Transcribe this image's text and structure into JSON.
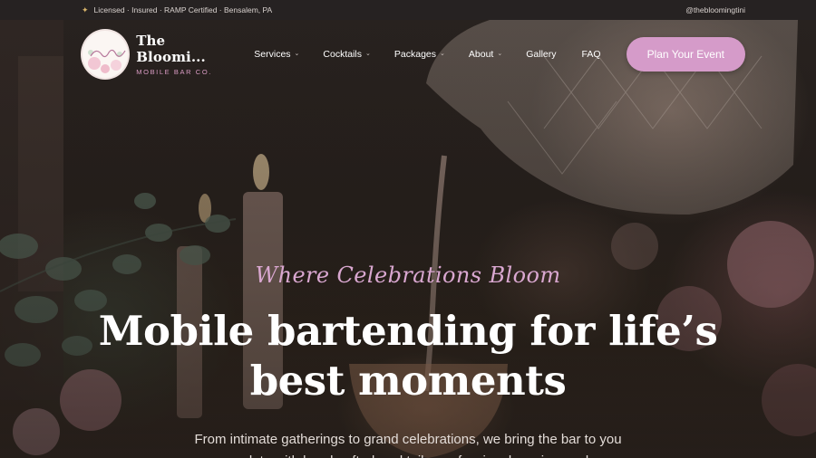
{
  "topbar": {
    "left_text": "Licensed · Insured · RAMP Certified · Bensalem, PA",
    "right_text": "@thebloomingtini"
  },
  "brand": {
    "name": "The Bloomi...",
    "subtitle": "MOBILE BAR CO.",
    "logo_script": "The Blooming Tini"
  },
  "nav": {
    "items": [
      {
        "label": "Services",
        "has_dropdown": true
      },
      {
        "label": "Cocktails",
        "has_dropdown": true
      },
      {
        "label": "Packages",
        "has_dropdown": true
      },
      {
        "label": "About",
        "has_dropdown": true
      },
      {
        "label": "Gallery",
        "has_dropdown": false
      },
      {
        "label": "FAQ",
        "has_dropdown": false
      }
    ],
    "cta_label": "Plan Your Event"
  },
  "hero": {
    "tagline": "Where Celebrations Bloom",
    "headline_line1": "Mobile bartending for life’s",
    "headline_line2": "best moments",
    "subtext": "From intimate gatherings to grand celebrations, we bring the bar to you complete with handcrafted cocktails, professional service, and a"
  },
  "colors": {
    "accent": "#d59bc9",
    "tagline": "#d9a7d0",
    "topbar_bg": "#262222",
    "icon_gold": "#d7b36a"
  },
  "icons": {
    "topbar_marker": "sparkle-icon",
    "dropdown": "chevron-down-icon"
  }
}
